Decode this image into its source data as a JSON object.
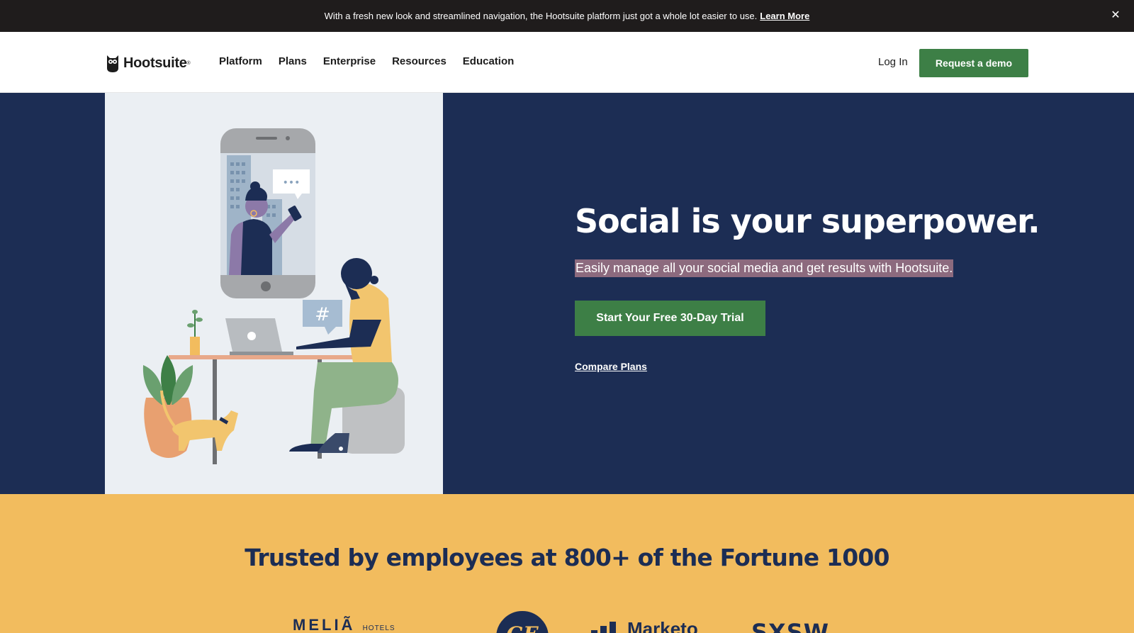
{
  "announcement": {
    "text": "With a fresh new look and streamlined navigation, the Hootsuite platform just got a whole lot easier to use.",
    "link_label": "Learn More",
    "close_glyph": "✕"
  },
  "nav": {
    "logo_text": "Hootsuite",
    "logo_reg": "®",
    "items": [
      {
        "label": "Platform"
      },
      {
        "label": "Plans"
      },
      {
        "label": "Enterprise"
      },
      {
        "label": "Resources"
      },
      {
        "label": "Education"
      }
    ],
    "login_label": "Log In",
    "demo_label": "Request a demo"
  },
  "hero": {
    "title": "Social is your superpower.",
    "subtitle": "Easily manage all your social media and get results with Hootsuite.",
    "cta_label": "Start Your Free 30-Day Trial",
    "compare_label": "Compare Plans",
    "chat_dots": "•••",
    "hashtag": "#"
  },
  "trusted": {
    "title": "Trusted by employees at 800+ of the Fortune 1000",
    "brands": {
      "melia": "MELIÃ",
      "melia_sub": "HOTELS",
      "ge": "GE",
      "marketo": "Marketo",
      "sxsw": "SXSW"
    }
  },
  "colors": {
    "navy": "#1c2d54",
    "green": "#3d7f46",
    "yellow": "#f2bc5e",
    "announce_bg": "#1f1c1c",
    "highlight": "#8c6a7e"
  }
}
